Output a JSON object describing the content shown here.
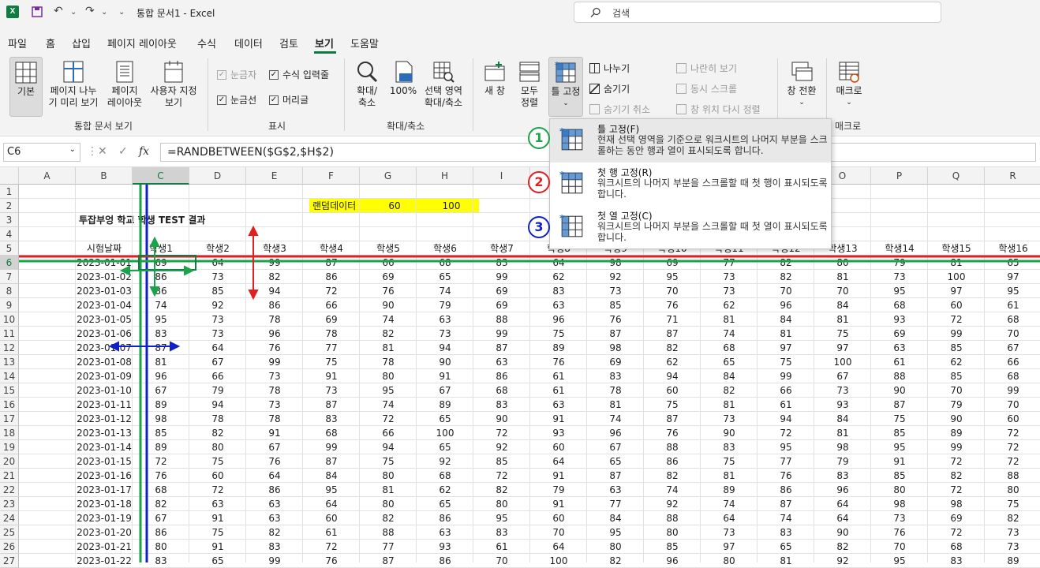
{
  "titlebar": {
    "logo": "X",
    "title": "통합 문서1 - Excel",
    "search_placeholder": "검색",
    "undo": "↶",
    "redo": "↷",
    "customize": "⌄"
  },
  "tabs": [
    "파일",
    "홈",
    "삽입",
    "페이지 레이아웃",
    "수식",
    "데이터",
    "검토",
    "보기",
    "도움말"
  ],
  "ribbon": {
    "workbook_views": {
      "group": "통합 문서 보기",
      "normal": "기본",
      "page_break": [
        "페이지 나누",
        "기 미리 보기"
      ],
      "page_layout": [
        "페이지",
        "레이아웃"
      ],
      "custom": [
        "사용자 지정",
        "보기"
      ]
    },
    "show": {
      "group": "표시",
      "ruler": "눈금자",
      "formula_bar": "수식 입력줄",
      "gridlines": "눈금선",
      "headings": "머리글"
    },
    "zoom": {
      "group": "확대/축소",
      "zoom": [
        "확대/",
        "축소"
      ],
      "zoom100": "100%",
      "zoom_selection": [
        "선택 영역",
        "확대/축소"
      ]
    },
    "window": {
      "new_window": "새 창",
      "arrange_all": [
        "모두",
        "정렬"
      ],
      "freeze": [
        "틀 고정"
      ],
      "split": "나누기",
      "hide": "숨기기",
      "unhide": "숨기기 취소",
      "side_by_side": "나란히 보기",
      "sync_scroll": "동시 스크롤",
      "reset_pos": "창 위치 다시 정렬",
      "switch": "창 전환"
    },
    "macros": {
      "group": "매크로",
      "label": "매크로"
    }
  },
  "formula_bar": {
    "cell": "C6",
    "formula": "=RANDBETWEEN($G$2,$H$2)",
    "fx": "fx"
  },
  "columns": [
    "A",
    "B",
    "C",
    "D",
    "E",
    "F",
    "G",
    "H",
    "I",
    "J",
    "K",
    "L",
    "M",
    "N",
    "O",
    "P",
    "Q",
    "R"
  ],
  "sheet": {
    "random_label": "랜덤데이터",
    "rand_min": "60",
    "rand_max": "100",
    "title": "투잡부엉 학교 학생 TEST 결과",
    "headers": [
      "시험날짜",
      "학생1",
      "학생2",
      "학생3",
      "학생4",
      "학생5",
      "학생6",
      "학생7",
      "학생8",
      "학생9",
      "학생10",
      "학생11",
      "학생12",
      "학생13",
      "학생14",
      "학생15",
      "학생16"
    ],
    "rows": [
      [
        "2023-01-01",
        "69",
        "64",
        "99",
        "87",
        "66",
        "68",
        "83",
        "64",
        "98",
        "69",
        "77",
        "82",
        "80",
        "79",
        "81",
        "65"
      ],
      [
        "2023-01-02",
        "86",
        "73",
        "82",
        "86",
        "69",
        "65",
        "99",
        "62",
        "92",
        "95",
        "73",
        "82",
        "81",
        "73",
        "100",
        "97"
      ],
      [
        "2023-01-03",
        "86",
        "85",
        "94",
        "72",
        "76",
        "74",
        "69",
        "83",
        "73",
        "70",
        "73",
        "70",
        "70",
        "95",
        "97",
        "95"
      ],
      [
        "2023-01-04",
        "74",
        "92",
        "86",
        "66",
        "90",
        "79",
        "69",
        "63",
        "85",
        "76",
        "62",
        "96",
        "84",
        "68",
        "60",
        "61"
      ],
      [
        "2023-01-05",
        "95",
        "73",
        "78",
        "69",
        "74",
        "63",
        "88",
        "96",
        "76",
        "71",
        "81",
        "84",
        "81",
        "93",
        "72",
        "68"
      ],
      [
        "2023-01-06",
        "83",
        "73",
        "96",
        "78",
        "82",
        "73",
        "99",
        "75",
        "87",
        "87",
        "74",
        "81",
        "75",
        "69",
        "99",
        "70"
      ],
      [
        "2023-01-07",
        "87",
        "64",
        "76",
        "77",
        "81",
        "94",
        "87",
        "89",
        "98",
        "82",
        "68",
        "97",
        "97",
        "63",
        "85",
        "67"
      ],
      [
        "2023-01-08",
        "81",
        "67",
        "99",
        "75",
        "78",
        "90",
        "63",
        "76",
        "69",
        "62",
        "65",
        "75",
        "100",
        "61",
        "62",
        "66"
      ],
      [
        "2023-01-09",
        "96",
        "66",
        "73",
        "91",
        "80",
        "91",
        "86",
        "61",
        "83",
        "94",
        "84",
        "99",
        "67",
        "88",
        "85",
        "68"
      ],
      [
        "2023-01-10",
        "67",
        "79",
        "78",
        "73",
        "95",
        "67",
        "68",
        "61",
        "78",
        "60",
        "82",
        "66",
        "73",
        "90",
        "70",
        "99"
      ],
      [
        "2023-01-11",
        "89",
        "94",
        "73",
        "87",
        "74",
        "89",
        "83",
        "63",
        "81",
        "75",
        "81",
        "61",
        "93",
        "87",
        "79",
        "70"
      ],
      [
        "2023-01-12",
        "98",
        "78",
        "78",
        "83",
        "72",
        "65",
        "90",
        "91",
        "74",
        "87",
        "73",
        "94",
        "84",
        "75",
        "90",
        "60"
      ],
      [
        "2023-01-13",
        "85",
        "82",
        "91",
        "68",
        "66",
        "100",
        "72",
        "93",
        "96",
        "76",
        "90",
        "72",
        "81",
        "85",
        "89",
        "72"
      ],
      [
        "2023-01-14",
        "89",
        "80",
        "67",
        "99",
        "94",
        "65",
        "92",
        "60",
        "67",
        "88",
        "83",
        "95",
        "98",
        "95",
        "99",
        "72"
      ],
      [
        "2023-01-15",
        "72",
        "75",
        "76",
        "87",
        "75",
        "92",
        "85",
        "64",
        "65",
        "86",
        "75",
        "77",
        "79",
        "91",
        "72",
        "72"
      ],
      [
        "2023-01-16",
        "76",
        "60",
        "64",
        "84",
        "80",
        "68",
        "72",
        "91",
        "87",
        "82",
        "81",
        "76",
        "83",
        "85",
        "82",
        "88"
      ],
      [
        "2023-01-17",
        "68",
        "72",
        "86",
        "95",
        "81",
        "62",
        "82",
        "79",
        "63",
        "74",
        "89",
        "86",
        "96",
        "80",
        "72",
        "80"
      ],
      [
        "2023-01-18",
        "82",
        "63",
        "63",
        "64",
        "80",
        "65",
        "80",
        "91",
        "77",
        "92",
        "74",
        "87",
        "64",
        "98",
        "98",
        "75"
      ],
      [
        "2023-01-19",
        "67",
        "91",
        "63",
        "60",
        "82",
        "86",
        "95",
        "60",
        "84",
        "88",
        "64",
        "74",
        "64",
        "73",
        "69",
        "82"
      ],
      [
        "2023-01-20",
        "86",
        "75",
        "82",
        "61",
        "88",
        "63",
        "83",
        "70",
        "95",
        "80",
        "73",
        "83",
        "90",
        "76",
        "72",
        "73"
      ],
      [
        "2023-01-21",
        "80",
        "91",
        "83",
        "72",
        "77",
        "93",
        "61",
        "64",
        "80",
        "85",
        "97",
        "65",
        "82",
        "70",
        "68",
        "73"
      ],
      [
        "2023-01-22",
        "83",
        "65",
        "99",
        "76",
        "87",
        "86",
        "70",
        "100",
        "82",
        "96",
        "80",
        "81",
        "92",
        "95",
        "83",
        "89"
      ]
    ]
  },
  "freeze_menu": {
    "items": [
      {
        "title": "틀 고정(F)",
        "desc": "현재 선택 영역을 기준으로 워크시트의 나머지 부분을 스크롤하는 동안 행과 열이 표시되도록 합니다.",
        "num": "1",
        "color": "#1aa34a"
      },
      {
        "title": "첫 행 고정(R)",
        "desc": "워크시트의 나머지 부분을 스크롤할 때 첫 행이 표시되도록 합니다.",
        "num": "2",
        "color": "#e02020"
      },
      {
        "title": "첫 열 고정(C)",
        "desc": "워크시트의 나머지 부분을 스크롤할 때 첫 열이 표시되도록 합니다.",
        "num": "3",
        "color": "#1020c8"
      }
    ]
  }
}
